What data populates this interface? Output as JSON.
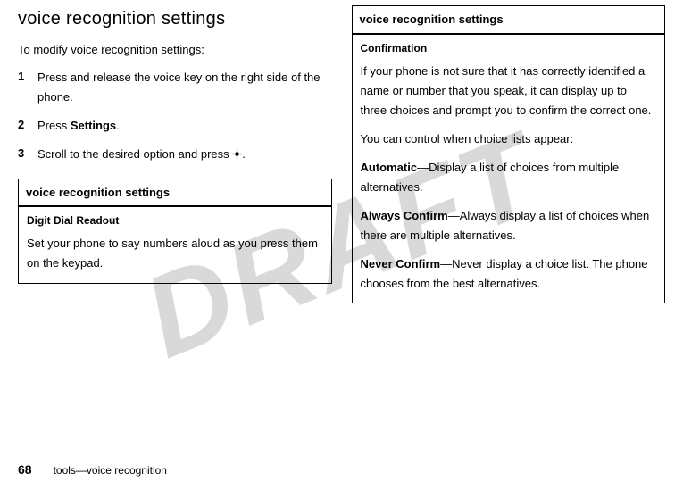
{
  "watermark": "DRAFT",
  "heading": "voice recognition settings",
  "intro": "To modify voice recognition settings:",
  "steps": [
    {
      "num": "1",
      "text": "Press and release the voice key on the right side of the phone."
    },
    {
      "num": "2",
      "prefix": "Press ",
      "bold": "Settings",
      "suffix": "."
    },
    {
      "num": "3",
      "prefix": "Scroll to the desired option and press ",
      "suffix": "."
    }
  ],
  "leftBox": {
    "header": "voice recognition settings",
    "sub": "Digit Dial Readout",
    "text": "Set your phone to say numbers aloud as you press them on the keypad."
  },
  "rightBox": {
    "header": "voice recognition settings",
    "sub": "Confirmation",
    "p1": "If your phone is not sure that it has correctly identified a name or number that you speak, it can display up to three choices and prompt you to confirm the correct one.",
    "p2": "You can control when choice lists appear:",
    "options": [
      {
        "name": "Automatic",
        "desc": "—Display a list of choices from multiple alternatives."
      },
      {
        "name": "Always Confirm",
        "desc": "—Always display a list of choices when there are multiple alternatives."
      },
      {
        "name": "Never Confirm",
        "desc": "—Never display a choice list. The phone chooses from the best alternatives."
      }
    ]
  },
  "footer": {
    "page": "68",
    "path": "tools—voice recognition"
  }
}
